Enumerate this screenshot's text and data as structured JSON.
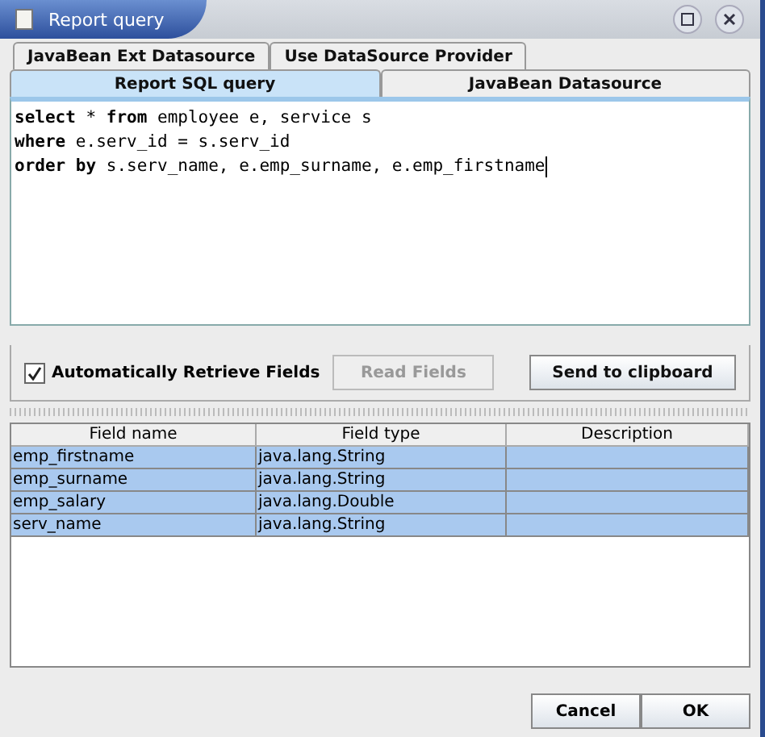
{
  "window": {
    "title": "Report query"
  },
  "tab_rows": [
    [
      {
        "label": "JavaBean Ext Datasource",
        "selected": false
      },
      {
        "label": "Use DataSource Provider",
        "selected": false
      }
    ],
    [
      {
        "label": "Report SQL query",
        "selected": true
      },
      {
        "label": "JavaBean Datasource",
        "selected": false
      }
    ]
  ],
  "query_lines": [
    "**select** * **from** employee e, service s",
    "**where** e.serv_id = s.serv_id",
    "**order by** s.serv_name, e.emp_surname, e.emp_firstname"
  ],
  "auto_retrieve": {
    "label": "Automatically Retrieve Fields",
    "checked": true
  },
  "read_fields": {
    "label": "Read Fields",
    "disabled": true
  },
  "send_button": "Send to clipboard",
  "table": {
    "columns": [
      "Field name",
      "Field type",
      "Description"
    ],
    "rows": [
      {
        "cells": [
          "emp_firstname",
          "java.lang.String"
        ],
        "selected": true
      },
      {
        "cells": [
          "emp_surname",
          "java.lang.String"
        ],
        "selected": true
      },
      {
        "cells": [
          "emp_salary",
          "java.lang.Double"
        ],
        "selected": true
      },
      {
        "cells": [
          "serv_name",
          "java.lang.String"
        ],
        "selected": true
      }
    ]
  },
  "buttons": [
    "Cancel",
    "OK"
  ]
}
